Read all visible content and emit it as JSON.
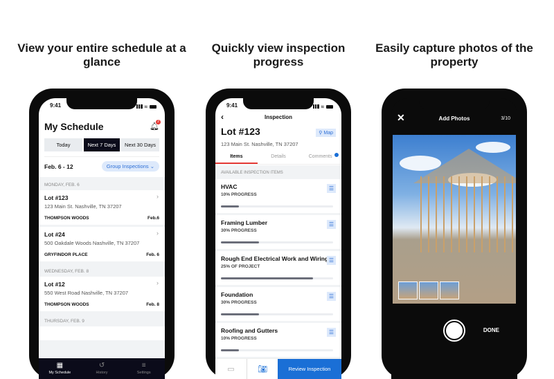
{
  "captions": [
    "View your entire schedule at a glance",
    "Quickly view inspection progress",
    "Easily capture photos of the property"
  ],
  "status_time": "9:41",
  "schedule": {
    "title": "My Schedule",
    "notif_count": "2",
    "segments": [
      "Today",
      "Next 7 Days",
      "Next 30 Days"
    ],
    "range": "Feb. 6 - 12",
    "group_btn": "Group Inspections ⌄",
    "days": [
      {
        "label": "MONDAY, FEB. 6",
        "cards": [
          {
            "lot": "Lot #123",
            "addr": "123 Main St. Nashville, TN 37207",
            "sub": "THOMPSON WOODS",
            "date": "Feb.6"
          },
          {
            "lot": "Lot #24",
            "addr": "500 Oakdale Woods Nashville, TN 37207",
            "sub": "GRYFINDOR PLACE",
            "date": "Feb. 6"
          }
        ]
      },
      {
        "label": "WEDNESDAY, FEB. 8",
        "cards": [
          {
            "lot": "Lot #12",
            "addr": "550 West Road Nashville, TN 37207",
            "sub": "THOMPSON WOODS",
            "date": "Feb. 8"
          }
        ]
      },
      {
        "label": "THURSDAY,  FEB. 9"
      }
    ],
    "tabs": [
      "My Schedule",
      "History",
      "Settings"
    ]
  },
  "inspection": {
    "nav_title": "Inspection",
    "lot": "Lot #123",
    "map": "Map",
    "addr": "123 Main St. Nashville, TN 37207",
    "tabs": [
      "Items",
      "Details",
      "Comments"
    ],
    "section": "AVAILABLE INSPECTION ITEMS",
    "items": [
      {
        "name": "HVAC",
        "progress_label": "10% PROGRESS",
        "fill": 16
      },
      {
        "name": "Framing Lumber",
        "progress_label": "30% PROGRESS",
        "fill": 34
      },
      {
        "name": "Rough End Electrical Work and Wiring",
        "progress_label": "25% OF PROJECT",
        "fill": 82
      },
      {
        "name": "Foundation",
        "progress_label": "30% PROGRESS",
        "fill": 34
      },
      {
        "name": "Roofing and Gutters",
        "progress_label": "10% PROGRESS",
        "fill": 16
      }
    ],
    "review": "Review Inspection"
  },
  "photos": {
    "title": "Add Photos",
    "count": "3/10",
    "done": "DONE"
  }
}
